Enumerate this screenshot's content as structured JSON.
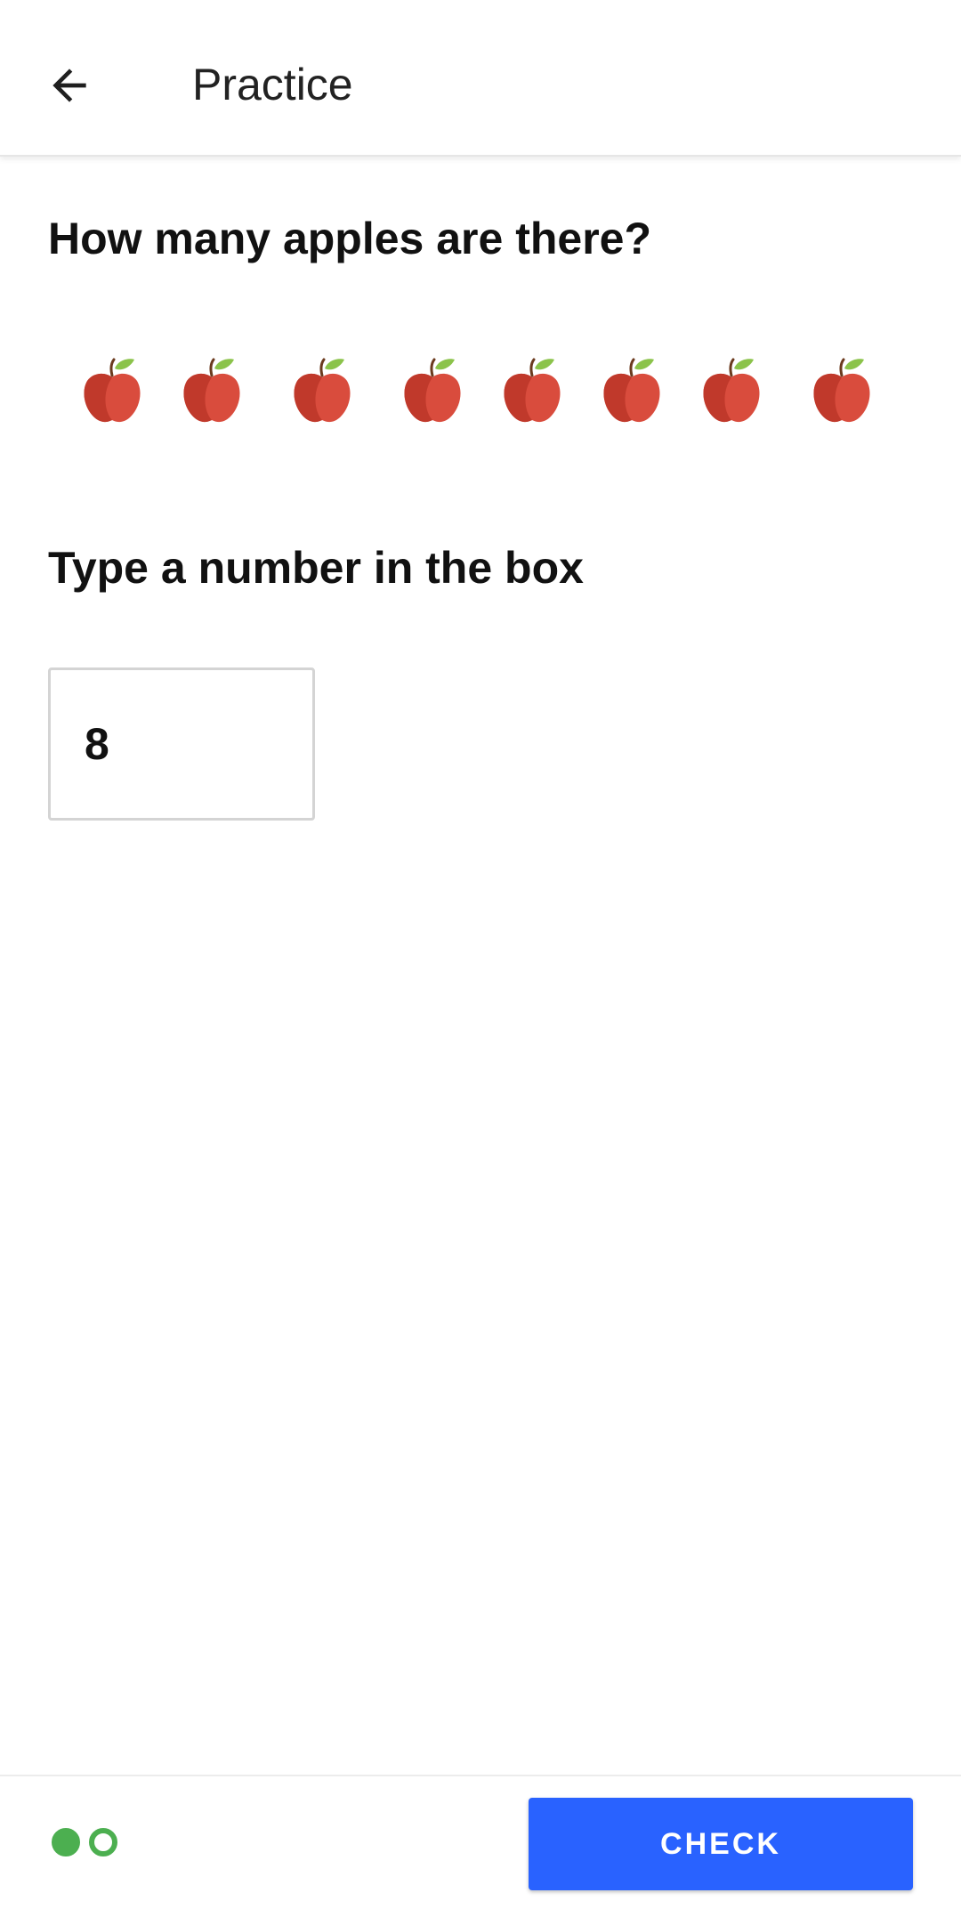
{
  "app_bar": {
    "back_icon": "arrow-back-icon",
    "title": "Practice"
  },
  "question": {
    "text": "How many apples are there?",
    "apple_icon": "apple-icon",
    "apple_count": 8
  },
  "instruction": {
    "text": "Type a number in the box"
  },
  "answer": {
    "value": "8"
  },
  "progress": {
    "total": 2,
    "completed": 1,
    "color": "#4caf50"
  },
  "check_button": {
    "label": "CHECK",
    "color": "#2962ff"
  }
}
